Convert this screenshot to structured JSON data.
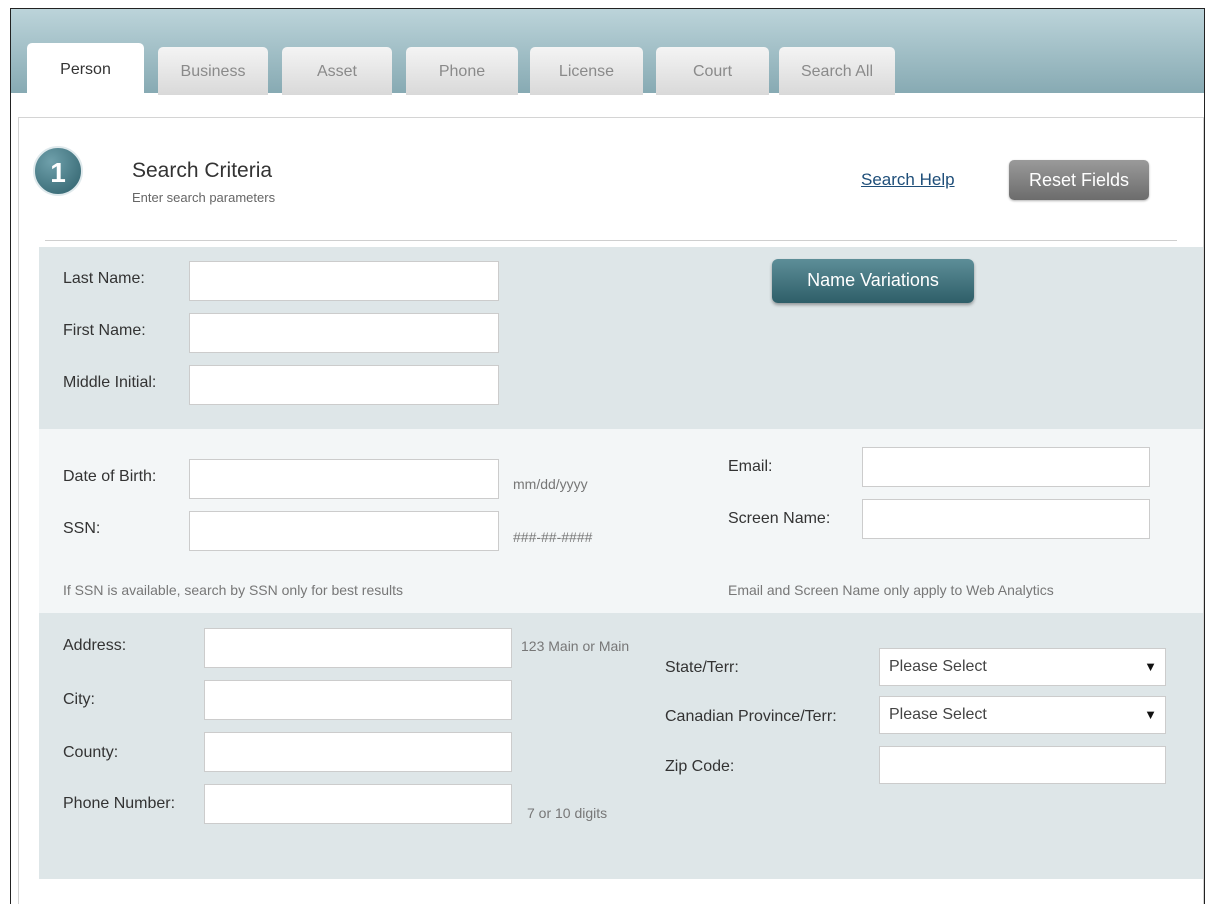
{
  "tabs": [
    "Person",
    "Business",
    "Asset",
    "Phone",
    "License",
    "Court",
    "Search All"
  ],
  "active_tab": "Person",
  "step": {
    "number": "1",
    "title": "Search Criteria",
    "subtitle": "Enter search parameters",
    "help_link": "Search Help",
    "reset_label": "Reset Fields"
  },
  "name_section": {
    "last_name_label": "Last Name:",
    "first_name_label": "First Name:",
    "middle_initial_label": "Middle Initial:",
    "name_variations_label": "Name Variations",
    "last_name_value": "",
    "first_name_value": "",
    "middle_initial_value": ""
  },
  "id_section": {
    "dob_label": "Date of Birth:",
    "dob_hint": "mm/dd/yyyy",
    "ssn_label": "SSN:",
    "ssn_hint": "###-##-####",
    "ssn_note": "If SSN is available, search by SSN only for best results",
    "email_label": "Email:",
    "screen_name_label": "Screen Name:",
    "web_note": "Email and Screen Name only apply to Web Analytics"
  },
  "address_section": {
    "address_label": "Address:",
    "address_hint": "123 Main or Main",
    "city_label": "City:",
    "county_label": "County:",
    "phone_label": "Phone Number:",
    "phone_hint": "7 or 10 digits",
    "state_label": "State/Terr:",
    "state_value": "Please Select",
    "province_label": "Canadian Province/Terr:",
    "province_value": "Please Select",
    "zip_label": "Zip Code:"
  }
}
